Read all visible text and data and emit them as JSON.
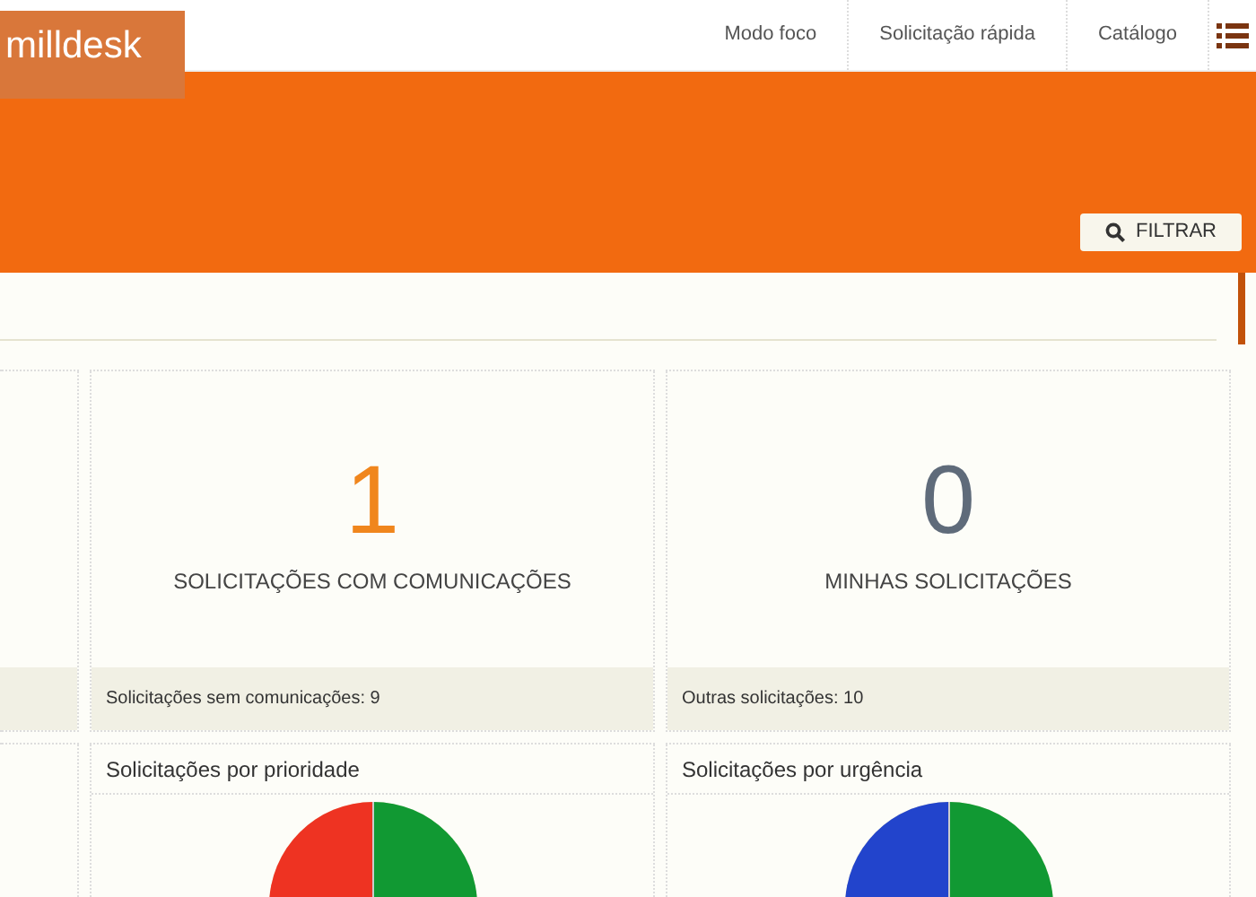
{
  "header": {
    "logo": "milldesk",
    "nav": [
      {
        "label": "Modo foco"
      },
      {
        "label": "Solicitação rápida"
      },
      {
        "label": "Catálogo"
      }
    ]
  },
  "filter_button": "FILTRAR",
  "stats": [
    {
      "value": "1",
      "color": "#f0861d",
      "label": "SOLICITAÇÕES COM COMUNICAÇÕES",
      "footer": "Solicitações sem comunicações: 9"
    },
    {
      "value": "0",
      "color": "#5f6b7a",
      "label": "MINHAS SOLICITAÇÕES",
      "footer": "Outras solicitações: 10"
    }
  ],
  "charts": [
    {
      "title": "Solicitações por prioridade",
      "kind": "priority"
    },
    {
      "title": "Solicitações por urgência",
      "kind": "urgency"
    }
  ]
}
